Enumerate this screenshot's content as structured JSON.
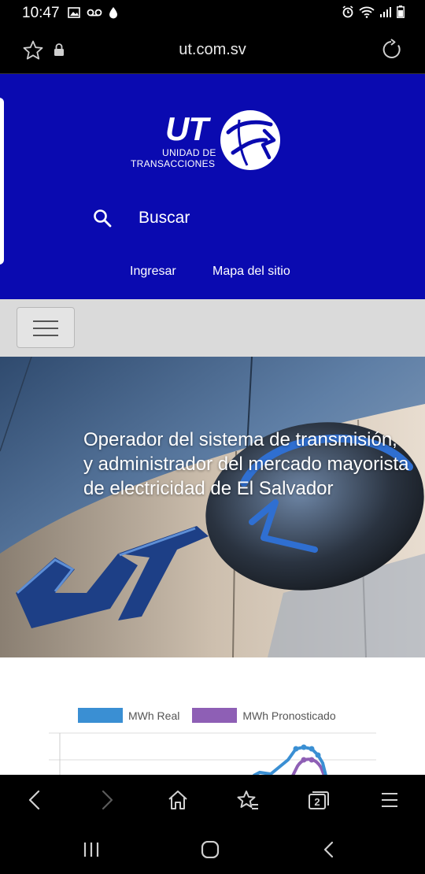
{
  "status_bar": {
    "time": "10:47"
  },
  "browser": {
    "url": "ut.com.sv"
  },
  "site": {
    "logo": {
      "abbr": "UT",
      "line1": "UNIDAD DE",
      "line2": "TRANSACCIONES"
    },
    "search_label": "Buscar",
    "links": {
      "login": "Ingresar",
      "sitemap": "Mapa del sitio"
    },
    "hero": {
      "line1": "Operador del sistema de transmisión,",
      "line2": "y administrador del mercado mayorista",
      "line3": "de electricidad de El Salvador"
    },
    "chart": {
      "legend": [
        {
          "name": "MWh Real",
          "color": "#3a8fd3"
        },
        {
          "name": "MWh Pronosticado",
          "color": "#8e5fb5"
        }
      ]
    }
  },
  "toolbar": {
    "tab_count": "2"
  },
  "colors": {
    "header_blue": "#0a0ab0",
    "nav_strip": "#dadada"
  }
}
